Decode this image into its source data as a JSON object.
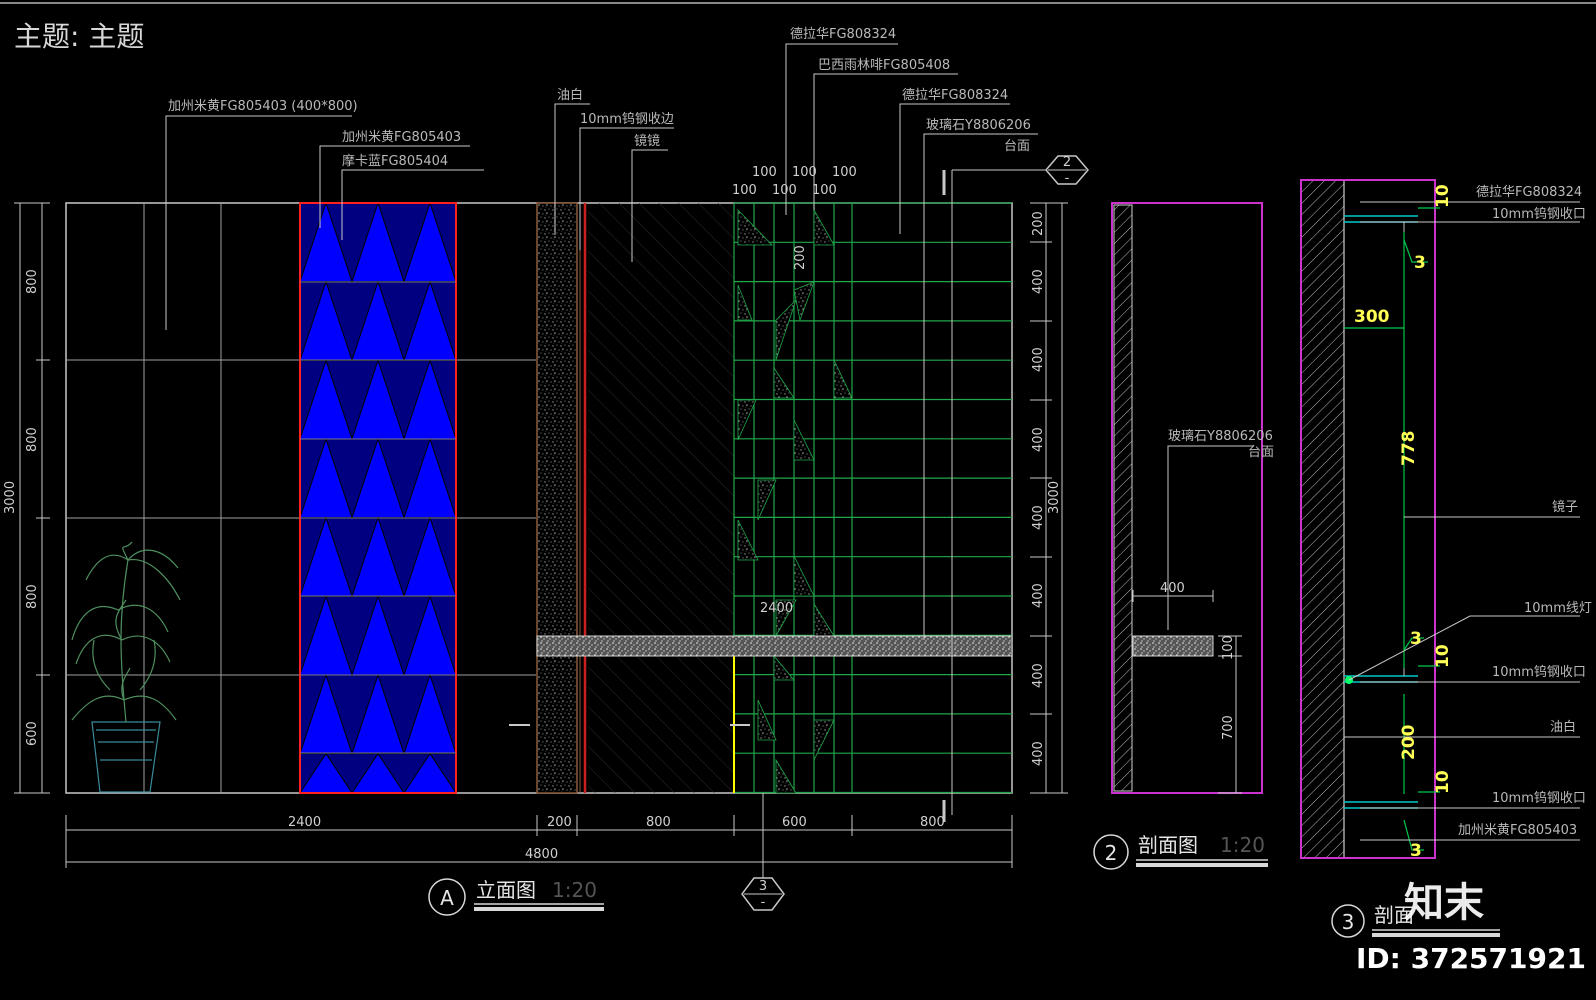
{
  "header": {
    "title": "主题: 主题"
  },
  "elevation": {
    "labels": {
      "beige_tile_400x800": "加州米黄FG805403 (400*800)",
      "beige_tile": "加州米黄FG805403",
      "mocha_blue": "摩卡蓝FG805404",
      "paint_white": "油白",
      "copper_edge": "10mm钨钢收边",
      "mirror": "镜镜",
      "dlh_top": "德拉华FG808324",
      "brazil": "巴西雨林啡FG805408",
      "dlh_2": "德拉华FG808324",
      "glass_stone": "玻璃石Y8806206",
      "countertop": "台面"
    },
    "dims_bottom": [
      "2400",
      "200",
      "800",
      "600",
      "800"
    ],
    "dim_total": "4800",
    "dims_left": [
      "800",
      "800",
      "800",
      "600"
    ],
    "dim_left_total": "3000",
    "dims_right": [
      "200",
      "400",
      "400",
      "400",
      "400",
      "400",
      "400",
      "400"
    ],
    "dim_right_total": "3000",
    "dims_top_grid_a": [
      "100",
      "100",
      "100"
    ],
    "dims_top_grid_b": [
      "100",
      "100",
      "100"
    ],
    "dim_200": "200",
    "dim_2400": "2400",
    "title": "立面图",
    "marker": "A",
    "scale": "1:20",
    "callout_2_num": "2",
    "callout_2_sub": "-",
    "callout_3_num": "3",
    "callout_3_sub": "-"
  },
  "section2": {
    "marker": "2",
    "title": "剖面图",
    "scale": "1:20",
    "label_stone": "玻璃石Y8806206",
    "label_counter": "台面",
    "dim_400": "400",
    "dim_100": "100",
    "dim_700": "700"
  },
  "section3": {
    "marker": "3",
    "title": "剖面",
    "labels": [
      "德拉华FG808324",
      "10mm钨钢收口",
      "镜子",
      "10mm线灯",
      "10mm钨钢收口",
      "油白",
      "10mm钨钢收口",
      "加州米黄FG805403"
    ],
    "dims": [
      "10",
      "3",
      "300",
      "778",
      "3",
      "10",
      "200",
      "10",
      "3"
    ]
  },
  "watermark": {
    "logo": "知末",
    "id": "ID: 372571921"
  },
  "colors": {
    "background": "#000000",
    "blue_panel": "#0000ff",
    "red_edge": "#ff2020",
    "green_grid": "#1fa84a",
    "magenta": "#cc33cc",
    "cyan": "#00c8c8",
    "yellow": "#ffff00",
    "lines": "#c8c8c8"
  }
}
